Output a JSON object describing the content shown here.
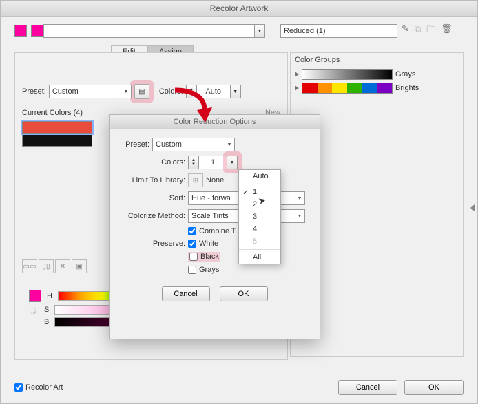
{
  "window_title": "Recolor Artwork",
  "top": {
    "name_field": "Reduced (1)",
    "icons": [
      "eyedropper",
      "disk",
      "folder",
      "trash"
    ]
  },
  "tabs": {
    "edit": "Edit",
    "assign": "Assign"
  },
  "main": {
    "preset_label": "Preset:",
    "preset_value": "Custom",
    "colors_label": "Colors:",
    "colors_value": "Auto",
    "current_colors_label": "Current Colors (4)",
    "new_label": "New",
    "bars": [
      {
        "color": "#e94b3c",
        "selected": true
      },
      {
        "color": "#111111",
        "selected": false
      }
    ],
    "hsb": {
      "h": "H",
      "s": "S",
      "b": "B"
    }
  },
  "groups": {
    "title": "Color Groups",
    "items": [
      {
        "name": "Grays"
      },
      {
        "name": "Brights"
      }
    ]
  },
  "dialog": {
    "title": "Color Reduction Options",
    "preset_label": "Preset:",
    "preset_value": "Custom",
    "colors_label": "Colors:",
    "colors_value": "1",
    "limit_label": "Limit To Library:",
    "limit_value": "None",
    "sort_label": "Sort:",
    "sort_value": "Hue - forwa",
    "method_label": "Colorize Method:",
    "method_value": "Scale Tints",
    "combine": "Combine T",
    "preserve_label": "Preserve:",
    "preserve_white": "White",
    "preserve_black": "Black",
    "preserve_grays": "Grays",
    "cancel": "Cancel",
    "ok": "OK"
  },
  "menu": {
    "items": [
      "Auto",
      "1",
      "2",
      "3",
      "4",
      "5",
      "All"
    ],
    "checked": "1",
    "disabled": [
      "5"
    ]
  },
  "footer": {
    "recolor": "Recolor Art",
    "cancel": "Cancel",
    "ok": "OK"
  }
}
